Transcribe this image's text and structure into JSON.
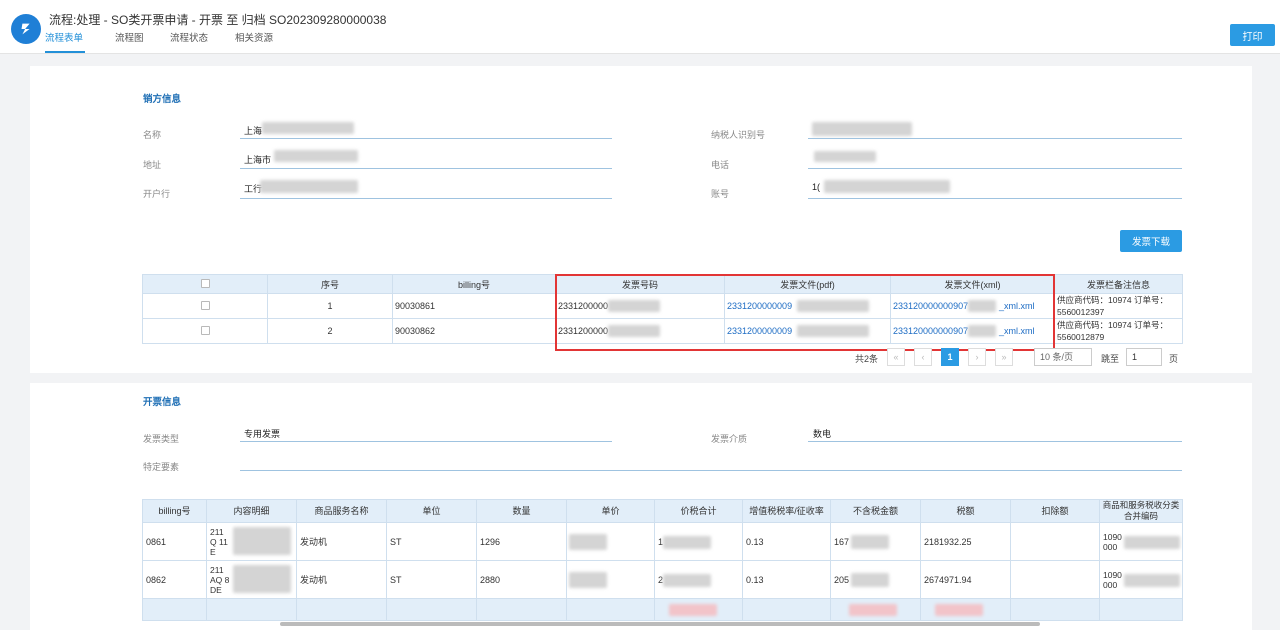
{
  "header": {
    "title": "流程:处理 - SO类开票申请 - 开票 至 归档 SO202309280000038",
    "tabs": [
      "流程表单",
      "流程图",
      "流程状态",
      "相关资源"
    ],
    "print_label": "打印"
  },
  "seller": {
    "section_title": "销方信息",
    "fields": {
      "name_label": "名称",
      "name_value": "上海",
      "address_label": "地址",
      "address_value": "上海市",
      "bank_label": "开户行",
      "bank_value": "工行",
      "taxid_label": "纳税人识别号",
      "phone_label": "电话",
      "account_label": "账号",
      "account_value": "1("
    }
  },
  "invoice_download_label": "发票下载",
  "invoice_table": {
    "headers": [
      "",
      "序号",
      "billing号",
      "发票号码",
      "发票文件(pdf)",
      "发票文件(xml)",
      "发票栏备注信息"
    ],
    "rows": [
      {
        "seq": "1",
        "billing": "90030861",
        "invoice_no": "2331200000",
        "pdf": "2331200000009",
        "xml": "233120000000907",
        "xml_suffix": "_xml.xml",
        "note": "供应商代码：10974 订单号：5560012397"
      },
      {
        "seq": "2",
        "billing": "90030862",
        "invoice_no": "2331200000",
        "pdf": "2331200000009",
        "xml": "233120000000907",
        "xml_suffix": "_xml.xml",
        "note": "供应商代码：10974 订单号：5560012879"
      }
    ]
  },
  "pagination": {
    "total": "共2条",
    "prev2": "«",
    "prev": "‹",
    "current": "1",
    "next": "›",
    "next2": "»",
    "page_size": "10 条/页",
    "jump_label": "跳至",
    "jump_value": "1",
    "page_unit": "页"
  },
  "billing_info": {
    "section_title": "开票信息",
    "type_label": "发票类型",
    "type_value": "专用发票",
    "medium_label": "发票介质",
    "medium_value": "数电",
    "special_label": "特定要素"
  },
  "detail_table": {
    "headers": [
      "billing号",
      "内容明细",
      "商品服务名称",
      "单位",
      "数量",
      "单价",
      "价税合计",
      "增值税税率/征收率",
      "不含税金额",
      "税额",
      "扣除额",
      "商品和服务税收分类合并编码"
    ],
    "rows": [
      {
        "billing": "0861",
        "detail": "211\nQ 11\nE",
        "goods": "发动机",
        "unit": "ST",
        "qty": "1296",
        "price": "",
        "total": "1",
        "rate": "0.13",
        "net": "167",
        "tax": "2181932.25",
        "deduct": "",
        "code": "1090\n000"
      },
      {
        "billing": "0862",
        "detail": "211\nAQ 8\nDE",
        "goods": "发动机",
        "unit": "ST",
        "qty": "2880",
        "price": "",
        "total": "2",
        "rate": "0.13",
        "net": "205",
        "tax": "2674971.94",
        "deduct": "",
        "code": "1090\n000"
      }
    ]
  }
}
